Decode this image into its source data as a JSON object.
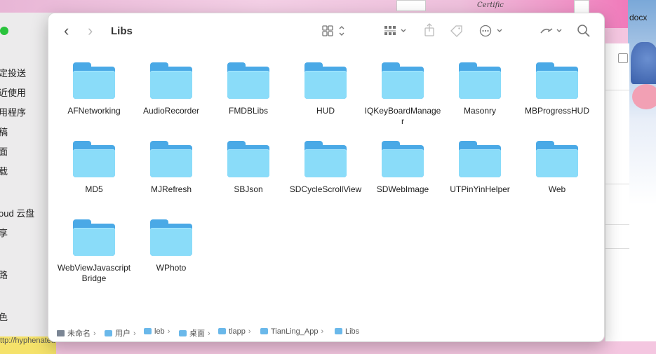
{
  "desktop": {
    "right_label": "docx",
    "paper_label": "Certific",
    "bottom_fragment": "ttp://hyphenateusr"
  },
  "sidebar": {
    "items": [
      "定投送",
      "近使用",
      "用程序",
      "稿",
      "面",
      "载",
      "oud 云盘",
      "享",
      "路",
      "色",
      "色"
    ]
  },
  "toolbar": {
    "back_icon": "‹",
    "forward_icon": "›",
    "title": "Libs",
    "view_icon": "view-grid-icon",
    "group_icon": "group-icon",
    "share_icon": "share-icon",
    "tag_icon": "tag-icon",
    "more_icon": "more-icon",
    "pen_icon": "pen-icon",
    "search_icon": "search-icon"
  },
  "folders": [
    "AFNetworking",
    "AudioRecorder",
    "FMDBLibs",
    "HUD",
    "IQKeyBoardManager",
    "Masonry",
    "MBProgressHUD",
    "MD5",
    "MJRefresh",
    "SBJson",
    "SDCycleScrollView",
    "SDWebImage",
    "UTPinYinHelper",
    "Web",
    "WebViewJavascriptBridge",
    "WPhoto"
  ],
  "pathbar": [
    "未命名",
    "用户",
    "leb",
    "桌面",
    "tlapp",
    "TianLing_App",
    "Libs"
  ],
  "colors": {
    "folder_back": "#4aa9e6",
    "folder_front": "#8adcf9",
    "window_bg": "#ffffff"
  }
}
